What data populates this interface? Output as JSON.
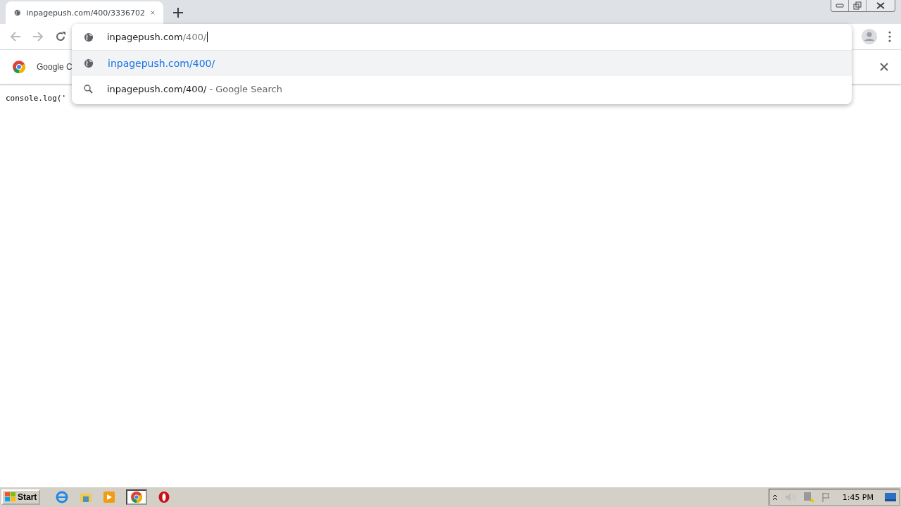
{
  "tab": {
    "title": "inpagepush.com/400/3336702"
  },
  "omnibox": {
    "value_host": "inpagepush.com",
    "value_path": "/400/"
  },
  "suggestions": [
    {
      "kind": "url",
      "text": "inpagepush.com/400/",
      "selected": true
    },
    {
      "kind": "search",
      "text": "inpagepush.com/400/",
      "suffix": " - Google Search",
      "selected": false
    }
  ],
  "infobar": {
    "message": "Google C"
  },
  "page": {
    "text": "console.log('"
  },
  "taskbar": {
    "start": "Start",
    "clock": "1:45 PM"
  }
}
